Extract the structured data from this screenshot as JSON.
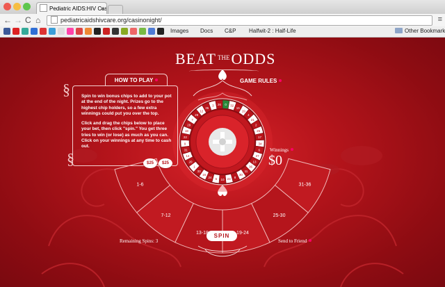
{
  "browser": {
    "tab_title": "Pediatric AIDS:HIV Casino",
    "tab_close": "×",
    "url": "pediatricaidshivcare.org/casinonight/",
    "nav": {
      "back": "←",
      "forward": "→",
      "reload": "C",
      "home": "⌂"
    },
    "menu": "≡",
    "bookmarks": [
      {
        "label": "Images",
        "color": "#4e7bd5"
      },
      {
        "label": "Docs",
        "color": "#4e7bd5"
      },
      {
        "label": "C&P",
        "color": "#ffffff"
      },
      {
        "label": "Halfwit-2 : Half-Life",
        "color": "#ffffff"
      }
    ],
    "other_bookmarks": "Other Bookmarks",
    "bookmark_icon_colors": [
      "#3b5998",
      "#d22",
      "#3a9",
      "#2f6fd6",
      "#d33",
      "#3b9fd9",
      "#ddd",
      "#f4a",
      "#d44",
      "#e83",
      "#222",
      "#c22",
      "#333",
      "#8a2",
      "#e66",
      "#7b4",
      "#4e7bd5",
      "#222"
    ]
  },
  "game": {
    "logo": {
      "beat": "BEAT",
      "the": "THE",
      "odds": "ODDS"
    },
    "how_to_play": "HOW TO PLAY",
    "game_rules": "GAME RULES",
    "instructions_1": "Spin to win bonus chips to add to your pot at the end of the night. Prizes go to the highest chip holders, so a few extra winnings could put you over the top.",
    "instructions_2": "Click and drag the chips below to place your bet, then click \"spin.\" You get three tries to win (or lose) as much as you can. Click on your winnings at any time to cash out.",
    "chips": [
      "$25",
      "$25"
    ],
    "winnings_label": "Winnings",
    "winnings_value": "$0",
    "bets": [
      "1-6",
      "7-12",
      "13-18",
      "19-24",
      "25-30",
      "31-36"
    ],
    "spin_label": "SPIN",
    "remaining_spins": "Remaining Spins: 3",
    "send_to_friend": "Send to Friend",
    "wheel_numbers": [
      "0",
      "32",
      "15",
      "19",
      "4",
      "21",
      "2",
      "25",
      "17",
      "34",
      "6",
      "27",
      "13",
      "36",
      "11",
      "30",
      "8",
      "23",
      "10",
      "5",
      "24",
      "16",
      "33",
      "1",
      "20",
      "14",
      "31",
      "9",
      "22",
      "18",
      "29",
      "7",
      "28",
      "12",
      "35",
      "3",
      "26"
    ]
  }
}
